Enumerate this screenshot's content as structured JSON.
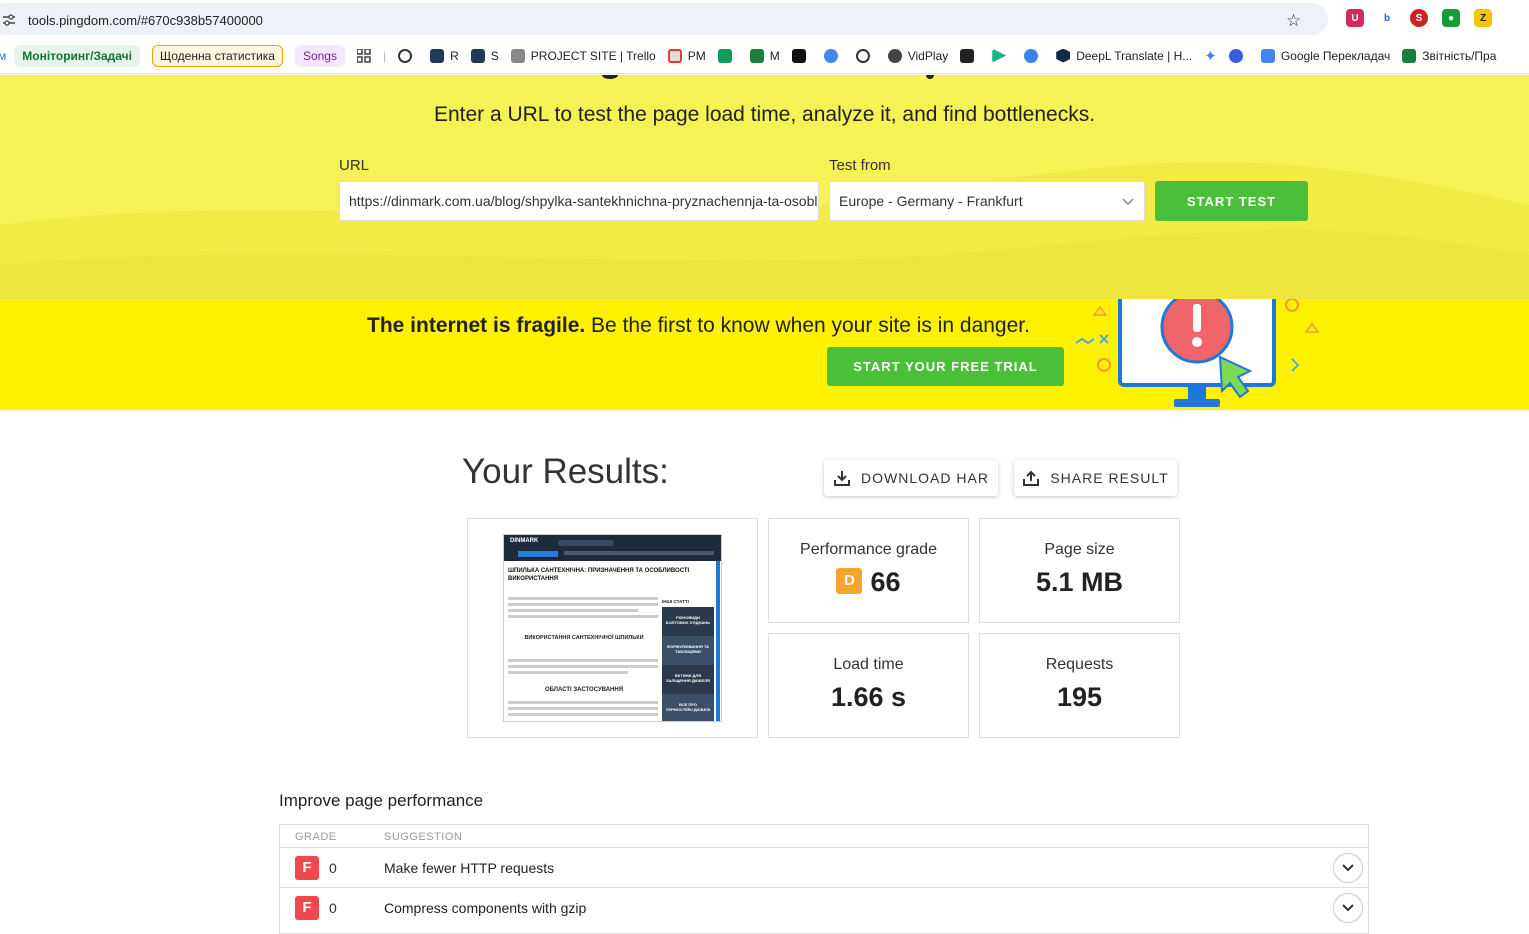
{
  "browser": {
    "url": "tools.pingdom.com/#670c938b57400000",
    "bookmarks": {
      "chip1": "Моніторинг/Задачі",
      "chip2": "Щоденна статистика",
      "chip3": "Songs",
      "b_r": "R",
      "b_s": "S",
      "b_trello": "PROJECT SITE | Trello",
      "b_pm": "PM",
      "b_m": "M",
      "b_vidplay": "VidPlay",
      "b_deepl": "DeepL Translate | H...",
      "b_google": "Google Перекладач",
      "b_report": "Звітність/Пра"
    }
  },
  "hero": {
    "subtitle": "Enter a URL to test the page load time, analyze it, and find bottlenecks.",
    "url_label": "URL",
    "url_value": "https://dinmark.com.ua/blog/shpylka-santekhnichna-pryznachennja-ta-osoblyvosti-vykorystannja",
    "test_from_label": "Test from",
    "test_from_value": "Europe - Germany - Frankfurt",
    "start_button": "START TEST"
  },
  "promo": {
    "bold": "The internet is fragile.",
    "rest": " Be the first to know when your site is in danger.",
    "trial_button": "START YOUR FREE TRIAL"
  },
  "results": {
    "title": "Your Results:",
    "download_button": "DOWNLOAD HAR",
    "share_button": "SHARE RESULT",
    "performance_label": "Performance grade",
    "performance_letter": "D",
    "performance_value": "66",
    "page_size_label": "Page size",
    "page_size_value": "5.1 MB",
    "load_time_label": "Load time",
    "load_time_value": "1.66 s",
    "requests_label": "Requests",
    "requests_value": "195"
  },
  "thumbnail": {
    "logo": "DINMARK",
    "heading": "ШПИЛЬКА САНТЕХНІЧНА: ПРИЗНАЧЕННЯ ТА ОСОБЛИВОСТІ ВИКОРИСТАННЯ",
    "section1": "ВИКОРИСТАННЯ САНТЕХНІЧНОЇ ШПИЛЬКИ",
    "section2": "ОБЛАСТІ ЗАСТОСУВАННЯ",
    "sidebar_title": "ІНШІ СТАТТІ",
    "side_items": [
      "РІЗНОВИДИ БОЛТОВИХ З'ЄДНАНЬ",
      "ФОРМУЛЮВАННЯ ТА ТАБЛИЦЯМИ",
      "ВКТИНИ ДЛЯ ЗАЛІЩЕННЯ ДЮБЕЛЯ",
      "ВСЕ ПРО ТЕРМОСТІЙКІ ДЮБЕЛІ"
    ]
  },
  "improve": {
    "title": "Improve page performance",
    "col_grade": "GRADE",
    "col_suggestion": "SUGGESTION",
    "rows": [
      {
        "grade": "F",
        "score": "0",
        "text": "Make fewer HTTP requests"
      },
      {
        "grade": "F",
        "score": "0",
        "text": "Compress components with gzip"
      }
    ]
  },
  "colors": {
    "hero_bg": "#f6f154",
    "promo_bg": "#fff200",
    "green": "#4bbf3a",
    "grade_d": "#f4a52d",
    "grade_f": "#f0484c"
  }
}
